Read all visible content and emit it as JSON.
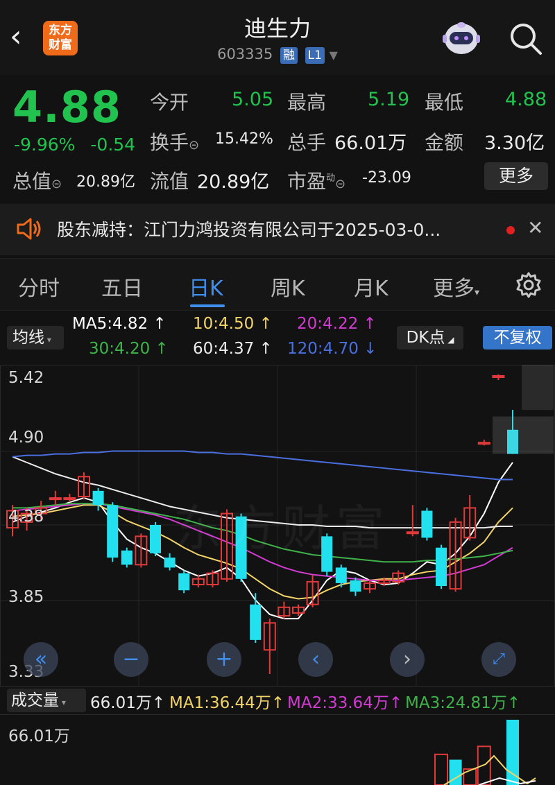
{
  "header": {
    "title": "迪生力",
    "code": "603335",
    "tag1": "融",
    "tag2": "L1",
    "logo_line1": "东方",
    "logo_line2": "财富"
  },
  "quote": {
    "price": "4.88",
    "change_pct": "-9.96%",
    "change_abs": "-0.54",
    "open_label": "今开",
    "open_value": "5.05",
    "high_label": "最高",
    "high_value": "5.19",
    "low_label": "最低",
    "low_value": "4.88",
    "turnover_label": "换手",
    "turnover_value": "15.42%",
    "volume_label": "总手",
    "volume_value": "66.01万",
    "amount_label": "金额",
    "amount_value": "3.30亿",
    "mktcap_label": "总值",
    "mktcap_value": "20.89亿",
    "float_label": "流值",
    "float_value": "20.89亿",
    "pe_label": "市盈",
    "pe_sup": "动",
    "pe_value": "-23.09",
    "more_label": "更多"
  },
  "notice": {
    "text": "股东减持：江门力鸿投资有限公司于2025-03-0..."
  },
  "tabs": {
    "items": [
      "分时",
      "五日",
      "日K",
      "周K",
      "月K",
      "更多"
    ],
    "active": "日K"
  },
  "ma": {
    "selector": "均线",
    "ma5": "MA5:4.82",
    "ma10": "10:4.50",
    "ma20": "20:4.22",
    "ma30": "30:4.20",
    "ma60": "60:4.37",
    "ma120": "120:4.70",
    "dk_label": "DK点",
    "fq_label": "不复权",
    "colors": {
      "ma5": "#ffffff",
      "ma10": "#f2d468",
      "ma20": "#d33bd3",
      "ma30": "#3fb34a",
      "ma60": "#ececec",
      "ma120": "#4a6fe0"
    }
  },
  "chart_data": {
    "type": "candlestick",
    "y_ticks": [
      "5.42",
      "4.90",
      "4.38",
      "3.85",
      "3.33"
    ],
    "ylim": [
      3.33,
      5.42
    ],
    "candles": [
      {
        "o": 4.36,
        "c": 4.48,
        "h": 4.52,
        "l": 4.3
      },
      {
        "o": 4.4,
        "c": 4.46,
        "h": 4.5,
        "l": 4.34
      },
      {
        "o": 4.46,
        "c": 4.5,
        "h": 4.55,
        "l": 4.42
      },
      {
        "o": 4.56,
        "c": 4.57,
        "h": 4.62,
        "l": 4.52
      },
      {
        "o": 4.56,
        "c": 4.57,
        "h": 4.6,
        "l": 4.54
      },
      {
        "o": 4.58,
        "c": 4.72,
        "h": 4.75,
        "l": 4.56
      },
      {
        "o": 4.62,
        "c": 4.52,
        "h": 4.64,
        "l": 4.48
      },
      {
        "o": 4.52,
        "c": 4.15,
        "h": 4.54,
        "l": 4.12
      },
      {
        "o": 4.2,
        "c": 4.1,
        "h": 4.22,
        "l": 4.08
      },
      {
        "o": 4.1,
        "c": 4.3,
        "h": 4.32,
        "l": 4.08
      },
      {
        "o": 4.38,
        "c": 4.18,
        "h": 4.4,
        "l": 4.16
      },
      {
        "o": 4.15,
        "c": 4.08,
        "h": 4.18,
        "l": 4.06
      },
      {
        "o": 4.04,
        "c": 3.92,
        "h": 4.06,
        "l": 3.9
      },
      {
        "o": 3.96,
        "c": 4.0,
        "h": 4.03,
        "l": 3.94
      },
      {
        "o": 3.96,
        "c": 4.04,
        "h": 4.06,
        "l": 3.94
      },
      {
        "o": 4.0,
        "c": 4.46,
        "h": 4.49,
        "l": 3.98
      },
      {
        "o": 4.44,
        "c": 4.0,
        "h": 4.46,
        "l": 3.98
      },
      {
        "o": 3.82,
        "c": 3.57,
        "h": 3.9,
        "l": 3.55
      },
      {
        "o": 3.5,
        "c": 3.69,
        "h": 3.72,
        "l": 3.33
      },
      {
        "o": 3.74,
        "c": 3.8,
        "h": 3.84,
        "l": 3.72
      },
      {
        "o": 3.76,
        "c": 3.8,
        "h": 3.82,
        "l": 3.74
      },
      {
        "o": 3.82,
        "c": 3.98,
        "h": 4.03,
        "l": 3.8
      },
      {
        "o": 4.3,
        "c": 4.05,
        "h": 4.32,
        "l": 4.02
      },
      {
        "o": 4.08,
        "c": 3.97,
        "h": 4.1,
        "l": 3.94
      },
      {
        "o": 3.99,
        "c": 3.91,
        "h": 4.01,
        "l": 3.88
      },
      {
        "o": 3.93,
        "c": 3.97,
        "h": 3.99,
        "l": 3.9
      },
      {
        "o": 3.97,
        "c": 3.99,
        "h": 4.01,
        "l": 3.95
      },
      {
        "o": 3.98,
        "c": 4.04,
        "h": 4.06,
        "l": 3.96
      },
      {
        "o": 4.32,
        "c": 4.33,
        "h": 4.52,
        "l": 4.3
      },
      {
        "o": 4.48,
        "c": 4.29,
        "h": 4.5,
        "l": 4.27
      },
      {
        "o": 4.22,
        "c": 3.95,
        "h": 4.24,
        "l": 3.93
      },
      {
        "o": 3.93,
        "c": 4.4,
        "h": 4.43,
        "l": 3.91
      },
      {
        "o": 4.29,
        "c": 4.5,
        "h": 4.59,
        "l": 4.27
      },
      {
        "o": 4.95,
        "c": 4.96,
        "h": 4.98,
        "l": 4.94
      },
      {
        "o": 5.42,
        "c": 5.43,
        "h": 5.44,
        "l": 5.4
      },
      {
        "o": 5.05,
        "c": 4.88,
        "h": 5.19,
        "l": 4.88
      }
    ],
    "ma_lines": {
      "ma5": [
        4.4,
        4.44,
        4.47,
        4.5,
        4.54,
        4.57,
        4.54,
        4.4,
        4.28,
        4.22,
        4.18,
        4.12,
        4.06,
        4.02,
        4.04,
        4.08,
        4.0,
        3.85,
        3.75,
        3.72,
        3.72,
        3.85,
        3.99,
        4.06,
        4.04,
        3.99,
        3.96,
        3.97,
        4.04,
        4.12,
        4.1,
        4.18,
        4.3,
        4.46,
        4.68,
        4.82
      ],
      "ma10": [
        4.44,
        4.45,
        4.46,
        4.48,
        4.5,
        4.52,
        4.52,
        4.47,
        4.41,
        4.37,
        4.33,
        4.28,
        4.22,
        4.17,
        4.14,
        4.11,
        4.07,
        4.0,
        3.93,
        3.88,
        3.86,
        3.87,
        3.92,
        3.96,
        3.98,
        3.99,
        4.0,
        4.0,
        4.03,
        4.05,
        4.06,
        4.12,
        4.18,
        4.26,
        4.4,
        4.5
      ],
      "ma20": [
        4.48,
        4.49,
        4.5,
        4.51,
        4.52,
        4.53,
        4.53,
        4.51,
        4.49,
        4.47,
        4.45,
        4.42,
        4.38,
        4.34,
        4.3,
        4.26,
        4.22,
        4.17,
        4.12,
        4.08,
        4.05,
        4.03,
        4.02,
        4.01,
        4.0,
        3.99,
        3.99,
        3.99,
        4.0,
        4.01,
        4.02,
        4.04,
        4.07,
        4.1,
        4.16,
        4.22
      ],
      "ma30": [
        4.5,
        4.5,
        4.51,
        4.52,
        4.53,
        4.53,
        4.53,
        4.52,
        4.5,
        4.48,
        4.46,
        4.44,
        4.42,
        4.39,
        4.36,
        4.34,
        4.31,
        4.27,
        4.24,
        4.21,
        4.19,
        4.17,
        4.16,
        4.15,
        4.14,
        4.13,
        4.12,
        4.12,
        4.12,
        4.13,
        4.13,
        4.14,
        4.15,
        4.16,
        4.18,
        4.2
      ],
      "ma60": [
        4.86,
        4.82,
        4.78,
        4.74,
        4.71,
        4.68,
        4.66,
        4.63,
        4.6,
        4.57,
        4.54,
        4.51,
        4.49,
        4.47,
        4.45,
        4.43,
        4.42,
        4.41,
        4.4,
        4.39,
        4.38,
        4.38,
        4.37,
        4.37,
        4.37,
        4.36,
        4.36,
        4.36,
        4.36,
        4.36,
        4.36,
        4.36,
        4.36,
        4.36,
        4.37,
        4.37
      ],
      "ma120": [
        4.86,
        4.87,
        4.87,
        4.88,
        4.88,
        4.89,
        4.89,
        4.9,
        4.9,
        4.9,
        4.9,
        4.9,
        4.9,
        4.89,
        4.89,
        4.88,
        4.88,
        4.87,
        4.86,
        4.85,
        4.84,
        4.83,
        4.82,
        4.81,
        4.8,
        4.79,
        4.78,
        4.77,
        4.76,
        4.75,
        4.74,
        4.73,
        4.72,
        4.71,
        4.7,
        4.7
      ]
    }
  },
  "volume": {
    "selector": "成交量",
    "vol": "66.01万",
    "ma1": "MA1:36.44万",
    "ma2": "MA2:33.64万",
    "ma3": "MA3:24.81万",
    "max_label": "66.01万",
    "bars": [
      {
        "v": 0.0,
        "up": true
      },
      {
        "v": 0.0,
        "up": true
      },
      {
        "v": 0.0,
        "up": true
      },
      {
        "v": 0.0,
        "up": true
      },
      {
        "v": 0.0,
        "up": true
      },
      {
        "v": 0.0,
        "up": true
      },
      {
        "v": 0.0,
        "up": true
      },
      {
        "v": 0.0,
        "up": true
      },
      {
        "v": 0.0,
        "up": true
      },
      {
        "v": 0.0,
        "up": true
      },
      {
        "v": 0.0,
        "up": true
      },
      {
        "v": 0.0,
        "up": true
      },
      {
        "v": 0.0,
        "up": true
      },
      {
        "v": 0.0,
        "up": true
      },
      {
        "v": 0.0,
        "up": true
      },
      {
        "v": 0.0,
        "up": true
      },
      {
        "v": 0.0,
        "up": true
      },
      {
        "v": 0.0,
        "up": true
      },
      {
        "v": 0.0,
        "up": true
      },
      {
        "v": 0.0,
        "up": true
      },
      {
        "v": 0.0,
        "up": true
      },
      {
        "v": 0.0,
        "up": true
      },
      {
        "v": 0.0,
        "up": true
      },
      {
        "v": 0.0,
        "up": true
      },
      {
        "v": 0.0,
        "up": true
      },
      {
        "v": 0.0,
        "up": true
      },
      {
        "v": 0.0,
        "up": true
      },
      {
        "v": 0.0,
        "up": true
      },
      {
        "v": 0.0,
        "up": true
      },
      {
        "v": 0.0,
        "up": true
      },
      {
        "v": 0.46,
        "up": true
      },
      {
        "v": 0.38,
        "up": false
      },
      {
        "v": 0.24,
        "up": true
      },
      {
        "v": 0.58,
        "up": true
      },
      {
        "v": 0.0,
        "up": true
      },
      {
        "v": 0.98,
        "up": false
      }
    ]
  },
  "colors": {
    "up": "#e23a3a",
    "down": "#22e0ee",
    "accent": "#3f8ef0",
    "price_down": "#21c24d"
  }
}
